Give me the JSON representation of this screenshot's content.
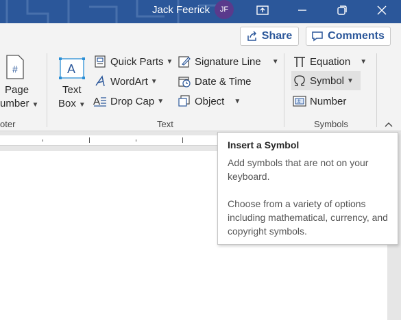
{
  "titlebar": {
    "user_name": "Jack Feerick",
    "avatar_initials": "JF",
    "bg_color": "#2b579a"
  },
  "actions": {
    "share_label": "Share",
    "comments_label": "Comments"
  },
  "groups": {
    "header_footer": {
      "label_partial": "oter",
      "page_number_line1": "Page",
      "page_number_line2": "umber"
    },
    "text": {
      "label": "Text",
      "text_box_line1": "Text",
      "text_box_line2": "Box",
      "quick_parts": "Quick Parts",
      "wordart": "WordArt",
      "drop_cap": "Drop Cap",
      "signature_line": "Signature Line",
      "date_time": "Date & Time",
      "object": "Object"
    },
    "symbols": {
      "label": "Symbols",
      "equation": "Equation",
      "symbol": "Symbol",
      "number": "Number"
    }
  },
  "tooltip": {
    "title": "Insert a Symbol",
    "p1": "Add symbols that are not on your keyboard.",
    "p2": "Choose from a variety of options including mathematical, currency, and copyright symbols."
  }
}
